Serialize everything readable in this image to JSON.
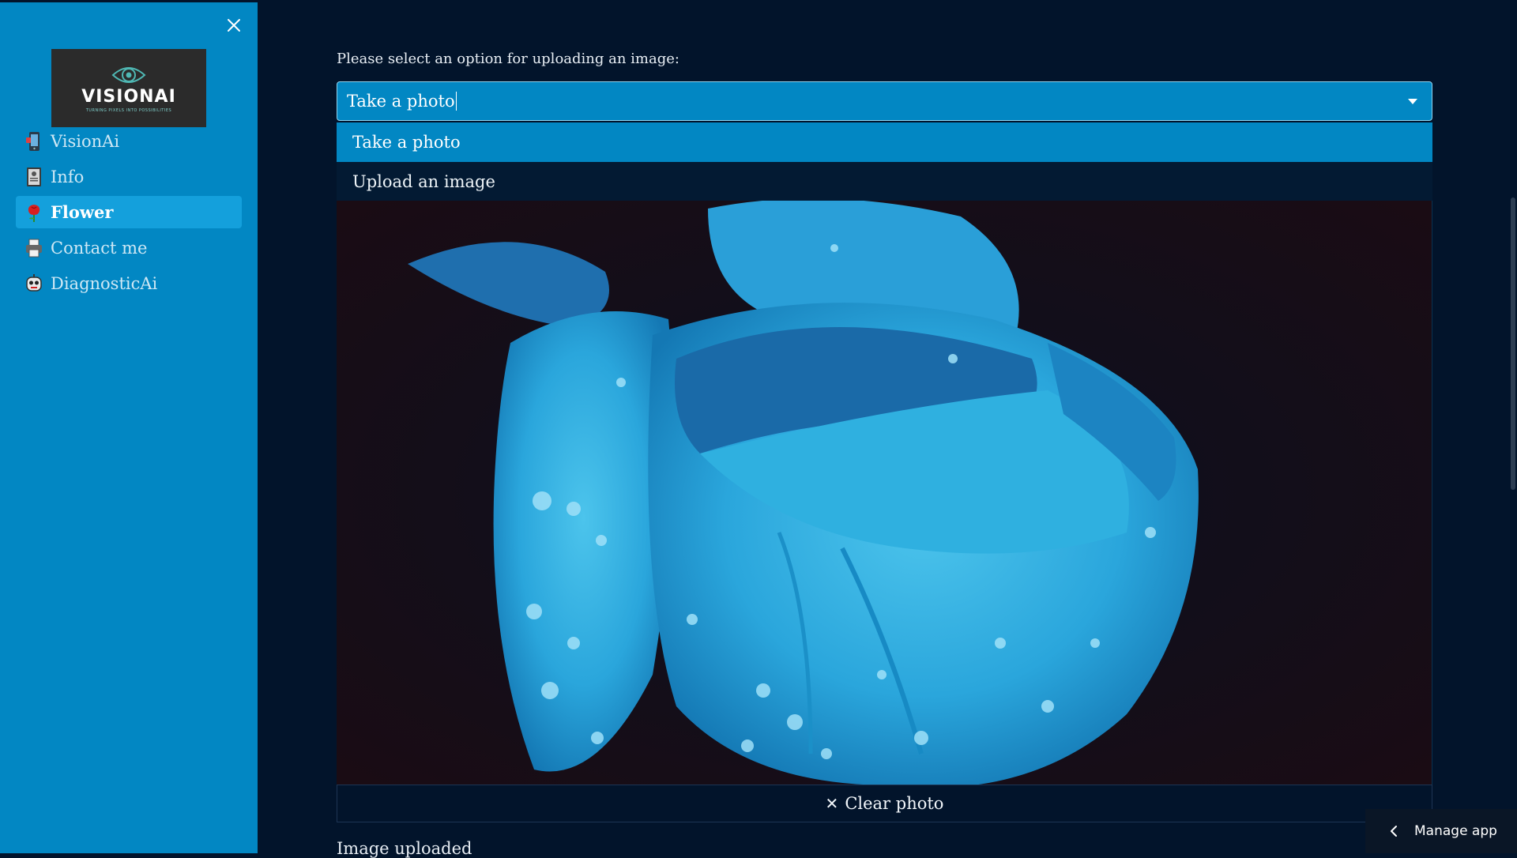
{
  "sidebar": {
    "logo": {
      "word": "VISIONAI",
      "tagline": "TURNING PIXELS INTO POSSIBILITIES"
    },
    "items": [
      {
        "label": "VisionAi",
        "icon": "phone-robot-icon",
        "active": false
      },
      {
        "label": "Info",
        "icon": "document-icon",
        "active": false
      },
      {
        "label": "Flower",
        "icon": "rose-icon",
        "active": true
      },
      {
        "label": "Contact me",
        "icon": "printer-icon",
        "active": false
      },
      {
        "label": "DiagnosticAi",
        "icon": "robot-face-icon",
        "active": false
      }
    ]
  },
  "main": {
    "select_label": "Please select an option for uploading an image:",
    "select_value": "Take a photo",
    "options": [
      "Take a photo",
      "Upload an image"
    ],
    "clear_button": "Clear photo",
    "uploaded_text": "Image uploaded"
  },
  "manage_app": "Manage app",
  "colors": {
    "sidebar_bg": "#0287c3",
    "main_bg": "#02142b",
    "accent": "#14a0dc"
  }
}
